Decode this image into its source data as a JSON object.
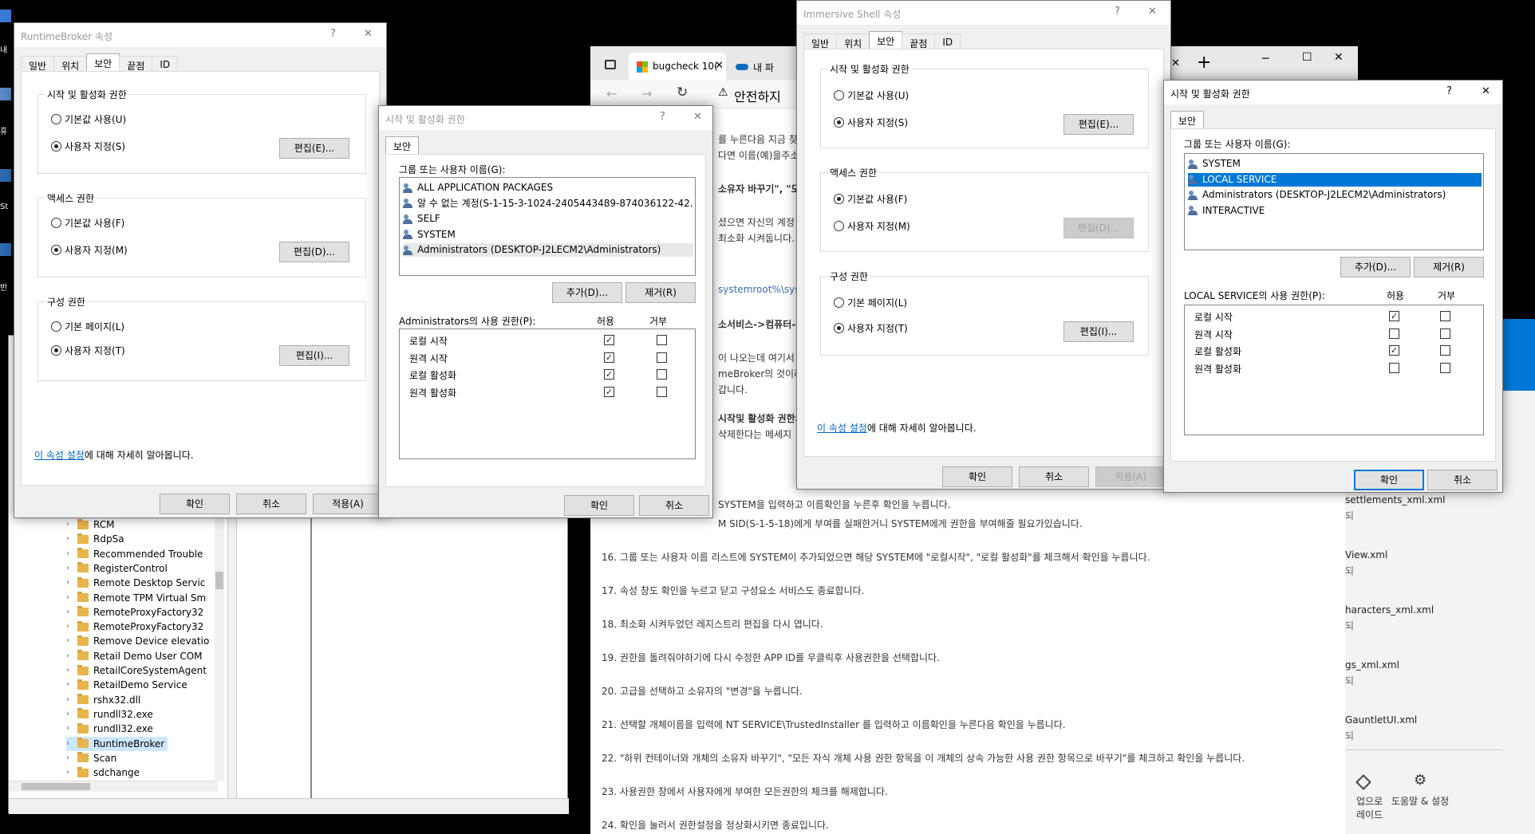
{
  "desktop": {
    "icon_labels": [
      "내",
      "휴",
      "St",
      "반"
    ]
  },
  "registry": {
    "items": [
      "RCM",
      "RdpSa",
      "Recommended Trouble",
      "RegisterControl",
      "Remote Desktop Servic",
      "Remote TPM Virtual Sm",
      "RemoteProxyFactory32",
      "RemoteProxyFactory32",
      "Remove Device elevatio",
      "Retail Demo User COM",
      "RetailCoreSystemAgent",
      "RetailDemo Service",
      "rshx32.dll",
      "rundll32.exe",
      "rundll32.exe",
      "RuntimeBroker",
      "Scan",
      "sdchange"
    ],
    "selected_index": 15
  },
  "browser": {
    "tab1_label": "bugcheck 10(",
    "tab2_label": "내 파",
    "warning_label": "안전하지",
    "new_tab_symbol": "+",
    "behind_snippets": [
      "를 누른다음 지금 찾",
      "다면 이름(예)을주소)",
      "소유자 바꾸기\", \"모",
      "셨으면 자신의 계정",
      "최소화 시켜둡니다.",
      "systemroot%\\sys",
      "소서비스->컴퓨터->",
      "이 나오는데 여기서",
      "meBroker의 것이리",
      "갑니다.",
      "시작및 활성화 권한의",
      "삭제한다는 메세지"
    ],
    "paragraphs": [
      "SYSTEM을 입력하고 이름확인을 누른후 확인을 누릅니다.",
      "M SID(S-1-5-18)에게 부여를 실패한거니 SYSTEM에게 권한을 부여해줄 필요가있습니다.",
      "16. 그룹 또는 사용자 이름 리스트에 SYSTEM이 추가되었으면 해당 SYSTEM에 \"로컬시작\", \"로컬 활성화\"를 체크해서 확인을 누릅니다.",
      "17. 속성 창도 확인을 누르고 닫고 구성요소 서비스도 종료합니다.",
      "18. 최소화 시켜두었던 레지스트리 편집을 다시 엽니다.",
      "19. 권한을 돌려줘야하기에 다시 수정한 APP ID를 우클릭후 사용권한을 선택합니다.",
      "20. 고급을 선택하고 소유자의 \"변경\"을 누릅니다.",
      "21. 선택할 개체이름을 입력에 NT SERVICE\\TrustedInstaller 를 입력하고 이름확인을 누른다음 확인을 누릅니다.",
      "22. \"하위 컨테이너와 개체의 소유자 바꾸기\", \"모든 자식 개체 사용 권한 항목을 이 개체의 상속 가능한 사용 권한 항목으로 바꾸기\"를 체크하고 확인을 누릅니다.",
      "23. 사용권한 창에서 사용자에게 부여한 모든권한의 체크를 해제합니다.",
      "24. 확인을 눌러서 권한설정을 정상화시키면 종료입니다."
    ]
  },
  "explorer": {
    "files": [
      "settlements_xml.xml",
      "View.xml",
      "haracters_xml.xml",
      "gs_xml.xml",
      "GauntletUI.xml"
    ],
    "file_sub": "되",
    "bottom_left": "업으로\n레이드",
    "bottom_right": "도움말 & 설정"
  },
  "common": {
    "tab_general": "일반",
    "tab_location": "위치",
    "tab_security": "보안",
    "tab_endpoints": "끝점",
    "tab_id": "ID",
    "launch_group": "시작 및 활성화 권한",
    "access_group": "액세스 권한",
    "config_group": "구성 권한",
    "use_default": "기본값 사용(U)",
    "customize": "사용자 지정(S)",
    "edit_launch": "편집(E)...",
    "access_default": "기본값 사용(F)",
    "access_custom": "사용자 지정(M)",
    "edit_access": "편집(D)...",
    "config_default": "기본 페이지(L)",
    "config_custom": "사용자 지정(T)",
    "edit_config": "편집(I)...",
    "learn_link": "이 속성 설정",
    "learn_rest": "에 대해 자세히 알아봅니다.",
    "ok": "확인",
    "cancel": "취소",
    "apply": "적용(A)",
    "help_q": "?",
    "close_x": "✕",
    "users_label": "그룹 또는 사용자 이름(G):",
    "add": "추가(D)...",
    "remove": "제거(R)",
    "allow": "허용",
    "deny": "거부",
    "perms": [
      "로컬 시작",
      "원격 시작",
      "로컬 활성화",
      "원격 활성화"
    ]
  },
  "rb_props": {
    "title": "RuntimeBroker 속성"
  },
  "rb_launch": {
    "title": "시작 및 활성화 권한",
    "tab": "보안",
    "users": [
      "ALL APPLICATION PACKAGES",
      "알 수 없는 계정(S-1-15-3-1024-2405443489-874036122-42...",
      "SELF",
      "SYSTEM",
      "Administrators (DESKTOP-J2LECM2\\Administrators)"
    ],
    "perm_label": "Administrators의 사용 권한(P):",
    "allow": [
      true,
      true,
      true,
      true
    ],
    "deny": [
      false,
      false,
      false,
      false
    ]
  },
  "is_props": {
    "title": "Immersive Shell 속성"
  },
  "is_launch": {
    "title": "시작 및 활성화 권한",
    "tab": "보안",
    "users": [
      "SYSTEM",
      "LOCAL SERVICE",
      "Administrators (DESKTOP-J2LECM2\\Administrators)",
      "INTERACTIVE"
    ],
    "perm_label": "LOCAL SERVICE의 사용 권한(P):",
    "allow": [
      true,
      false,
      true,
      false
    ],
    "deny": [
      false,
      false,
      false,
      false
    ]
  },
  "colors": {
    "accent": "#0078d7",
    "link": "#0066cc"
  }
}
